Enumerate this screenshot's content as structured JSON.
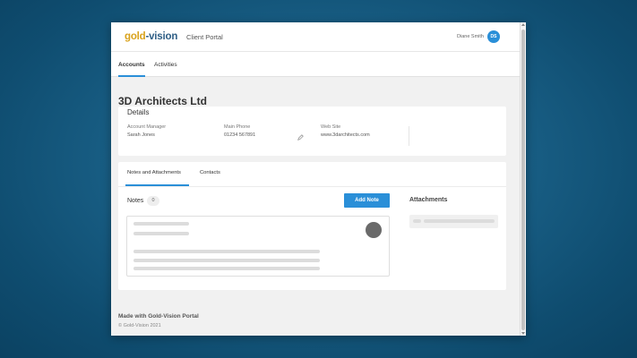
{
  "header": {
    "logo_part1": "gold",
    "logo_part2": "-vision",
    "portal_title": "Client Portal",
    "user_name": "Diane Smith",
    "user_initials": "DS"
  },
  "nav": {
    "tabs": [
      {
        "label": "Accounts",
        "active": true
      },
      {
        "label": "Activities",
        "active": false
      }
    ]
  },
  "account": {
    "name": "3D Architects Ltd",
    "details_title": "Details",
    "fields": [
      {
        "label": "Account Manager",
        "value": "Sarah Jones"
      },
      {
        "label": "Main Phone",
        "value": "01234 567891"
      },
      {
        "label": "Web Site",
        "value": "www.3darchitects.com"
      }
    ]
  },
  "notes_section": {
    "tabs": [
      {
        "label": "Notes and Attachments",
        "active": true
      },
      {
        "label": "Contacts",
        "active": false
      }
    ],
    "notes_label": "Notes",
    "notes_count": "0",
    "add_note_label": "Add Note",
    "attachments_label": "Attachments"
  },
  "footer": {
    "made_with": "Made with Gold-Vision Portal",
    "copyright": "© Gold-Vision 2021"
  },
  "colors": {
    "accent": "#2a8fd8",
    "logo_gold": "#d9a21b",
    "logo_blue": "#2f5f86",
    "background": "#0f4d70"
  }
}
